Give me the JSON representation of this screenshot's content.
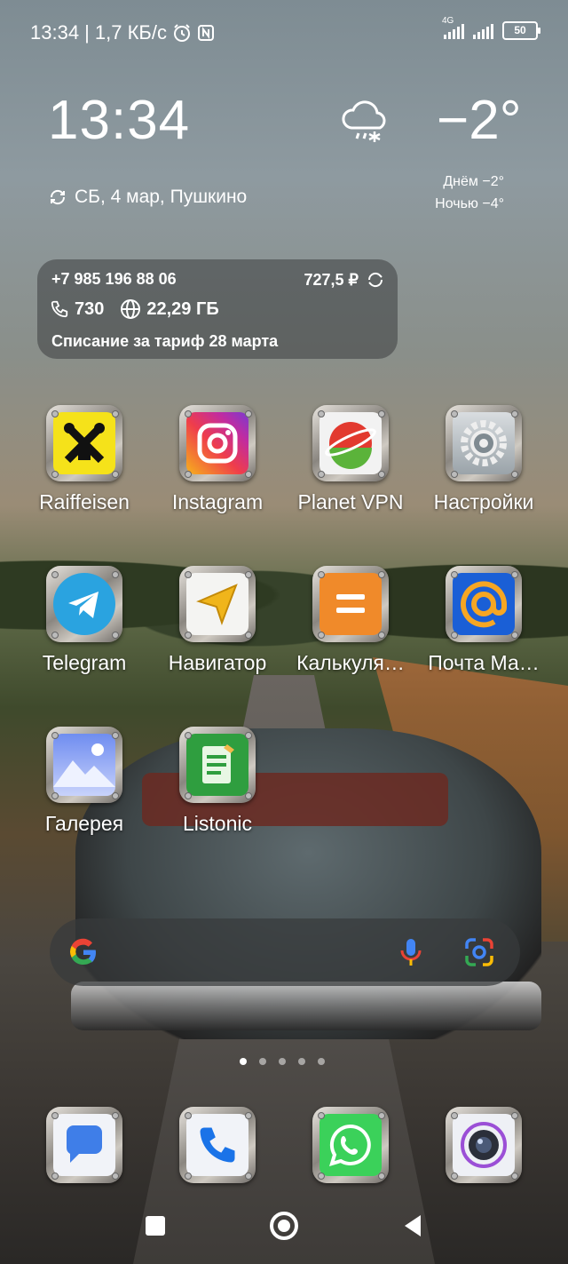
{
  "status_bar": {
    "time": "13:34",
    "speed": "| 1,7 КБ/с",
    "network": "4G",
    "battery": "50"
  },
  "clock_widget": {
    "time": "13:34",
    "date_location": "СБ, 4 мар, Пушкино"
  },
  "weather_widget": {
    "icon": "snow-cloud-icon",
    "temperature": "−2°",
    "day": "Днём −2°",
    "night": "Ночью −4°"
  },
  "operator_widget": {
    "phone": "+7 985 196 88 06",
    "balance": "727,5 ₽",
    "minutes": "730",
    "data": "22,29 ГБ",
    "charge_note": "Списание за тариф 28 марта"
  },
  "apps": [
    {
      "label": "Raiffeisen",
      "icon": "raiffeisen-icon"
    },
    {
      "label": "Instagram",
      "icon": "instagram-icon"
    },
    {
      "label": "Planet VPN",
      "icon": "planet-vpn-icon"
    },
    {
      "label": "Настройки",
      "icon": "settings-gear-icon"
    },
    {
      "label": "Telegram",
      "icon": "telegram-icon"
    },
    {
      "label": "Навигатор",
      "icon": "navigator-icon"
    },
    {
      "label": "Калькуля…",
      "icon": "calculator-icon"
    },
    {
      "label": "Почта Ма…",
      "icon": "mail-icon"
    },
    {
      "label": "Галерея",
      "icon": "gallery-icon"
    },
    {
      "label": "Listonic",
      "icon": "listonic-icon"
    }
  ],
  "dock": [
    {
      "icon": "messages-icon"
    },
    {
      "icon": "phone-icon"
    },
    {
      "icon": "whatsapp-icon"
    },
    {
      "icon": "camera-icon"
    }
  ],
  "pages": {
    "count": 5,
    "active": 0
  },
  "colors": {
    "raiffeisen": "#f5e21a",
    "telegram": "#2aa3e0",
    "whatsapp": "#3bd15a",
    "navigator": "#f0b51b",
    "calculator": "#f08a2a",
    "mail": "#1a5fd6"
  }
}
